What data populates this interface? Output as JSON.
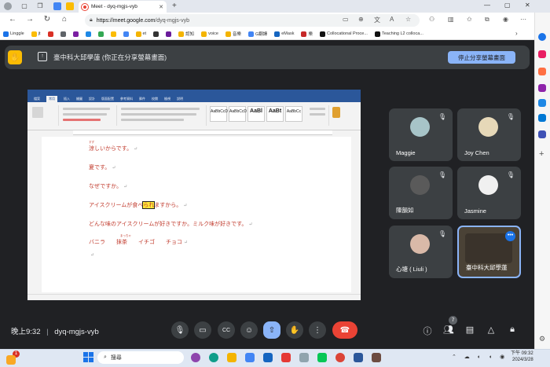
{
  "browser": {
    "tab_title": "Meet - dyq-mgjs-vyb",
    "url_host": "https://meet.google.com",
    "url_path": "/dyq-mgjs-vyb",
    "bookmarks": [
      "Linggle",
      "jt",
      "",
      "",
      "",
      "",
      "",
      "",
      "",
      "et",
      "",
      "",
      "認知",
      "voice",
      "音樂",
      "G翻譯",
      "eMask",
      "樂",
      "Collocational Proce...",
      "Teaching L2 colloca..."
    ]
  },
  "presenting": {
    "message": "臺中科大邱學蓮 (你正在分享螢幕畫面)",
    "stop_label": "停止分享螢幕畫面"
  },
  "document": {
    "lines": [
      {
        "text": "涼しいからです。",
        "ruby": "すず"
      },
      {
        "text": "夏です。"
      },
      {
        "text": "なぜですか。"
      },
      {
        "pre": "アイスクリームが食べ",
        "highlight": "られ",
        "post": "ますから。"
      },
      {
        "text": "どんな味のアイスクリームが好きですか。ミルク味が好きです。"
      },
      {
        "text": "バニラ　　抹茶　　イチゴ　　チョコ",
        "ruby": "まっちゃ"
      }
    ],
    "styles": [
      "AaBbCcD",
      "AaBbCcD",
      "AaBl",
      "AaBt",
      "AaBbCc"
    ],
    "style_names": [
      "一般",
      "無間距",
      "標題 1",
      "標題 2",
      "標題"
    ]
  },
  "participants": [
    {
      "name": "Maggie",
      "muted": true
    },
    {
      "name": "Joy Chen",
      "muted": true
    },
    {
      "name": "陳韻如",
      "muted": true
    },
    {
      "name": "Jasmine",
      "muted": true
    },
    {
      "name": "心塘 ( Liuli )",
      "muted": true
    },
    {
      "name": "臺中科大邱學蓮",
      "muted": false,
      "active": true
    }
  ],
  "meeting": {
    "time_label": "晚上9:32",
    "code": "dyq-mgjs-vyb",
    "people_count": "7"
  },
  "taskbar": {
    "search_placeholder": "搜尋",
    "time": "下午 09:32",
    "date": "2024/3/28",
    "notification_count": "1"
  }
}
